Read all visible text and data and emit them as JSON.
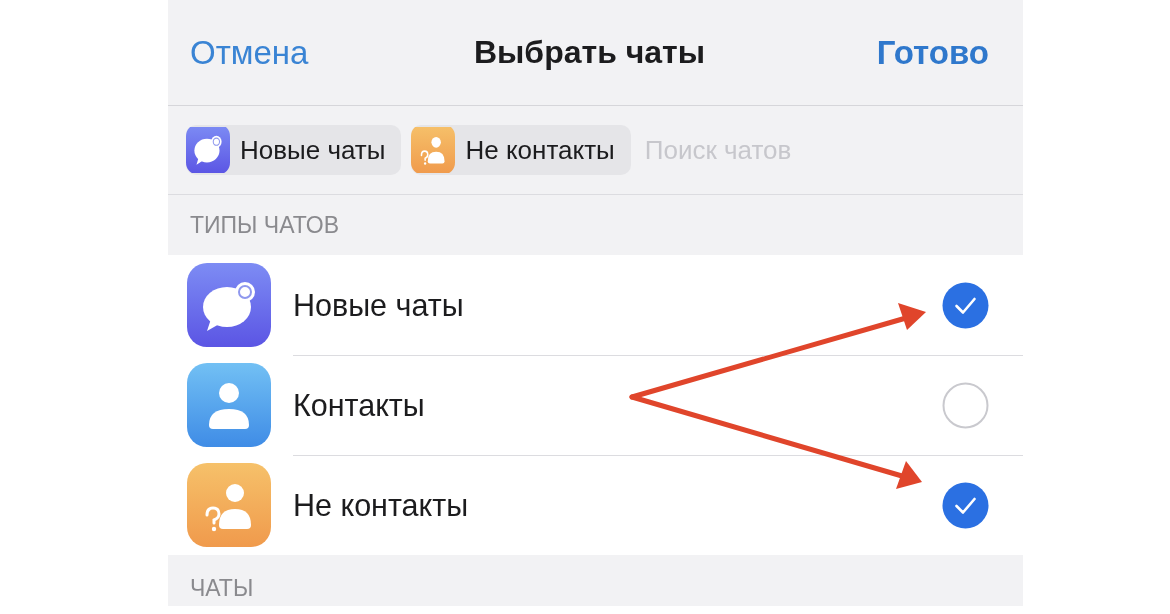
{
  "nav": {
    "cancel": "Отмена",
    "title": "Выбрать чаты",
    "done": "Готово"
  },
  "search": {
    "chips": [
      {
        "label": "Новые чаты",
        "kind": "new-chats"
      },
      {
        "label": "Не контакты",
        "kind": "non-contacts"
      }
    ],
    "placeholder": "Поиск чатов"
  },
  "sections": [
    {
      "header": "ТИПЫ ЧАТОВ",
      "items": [
        {
          "label": "Новые чаты",
          "kind": "new-chats",
          "checked": true
        },
        {
          "label": "Контакты",
          "kind": "contacts",
          "checked": false
        },
        {
          "label": "Не контакты",
          "kind": "non-contacts",
          "checked": true
        }
      ]
    },
    {
      "header": "ЧАТЫ"
    }
  ]
}
